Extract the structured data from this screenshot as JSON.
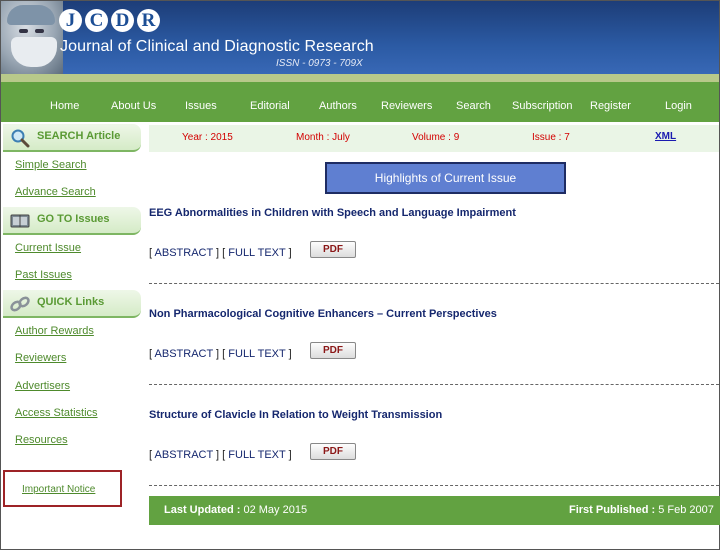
{
  "header": {
    "logo_letters": [
      "J",
      "C",
      "D",
      "R"
    ],
    "journal_name": "Journal of Clinical and Diagnostic Research",
    "issn": "ISSN - 0973 - 709X"
  },
  "nav": {
    "items": [
      "Home",
      "About Us",
      "Issues",
      "Editorial",
      "Authors",
      "Reviewers",
      "Search",
      "Subscription",
      "Register",
      "Login"
    ]
  },
  "sidebar": {
    "search_header": "SEARCH Article",
    "simple_search": "Simple Search",
    "advance_search": "Advance Search",
    "goto_header": "GO TO Issues",
    "current_issue": "Current Issue",
    "past_issues": "Past Issues",
    "quick_header": "QUICK Links",
    "author_rewards": "Author Rewards",
    "reviewers": "Reviewers",
    "advertisers": "Advertisers",
    "access_statistics": "Access Statistics",
    "resources": "Resources",
    "important_notice": "Important Notice"
  },
  "issue": {
    "year": "Year : 2015",
    "month": "Month : July",
    "volume": "Volume : 9",
    "issue": "Issue : 7",
    "xml": "XML"
  },
  "highlights_label": "Highlights of Current Issue",
  "articles": [
    {
      "title": "EEG Abnormalities in Children with Speech and Language Impairment",
      "abstract": "ABSTRACT",
      "full_text": "FULL TEXT",
      "pdf": "PDF"
    },
    {
      "title": "Non Pharmacological Cognitive Enhancers – Current Perspectives",
      "abstract": "ABSTRACT",
      "full_text": "FULL TEXT",
      "pdf": "PDF"
    },
    {
      "title": "Structure of Clavicle In Relation to Weight Transmission",
      "abstract": "ABSTRACT",
      "full_text": "FULL TEXT",
      "pdf": "PDF"
    }
  ],
  "footer": {
    "last_updated_label": "Last Updated :",
    "last_updated_value": "02 May 2015",
    "first_published_label": "First Published :",
    "first_published_value": "5 Feb 2007"
  }
}
